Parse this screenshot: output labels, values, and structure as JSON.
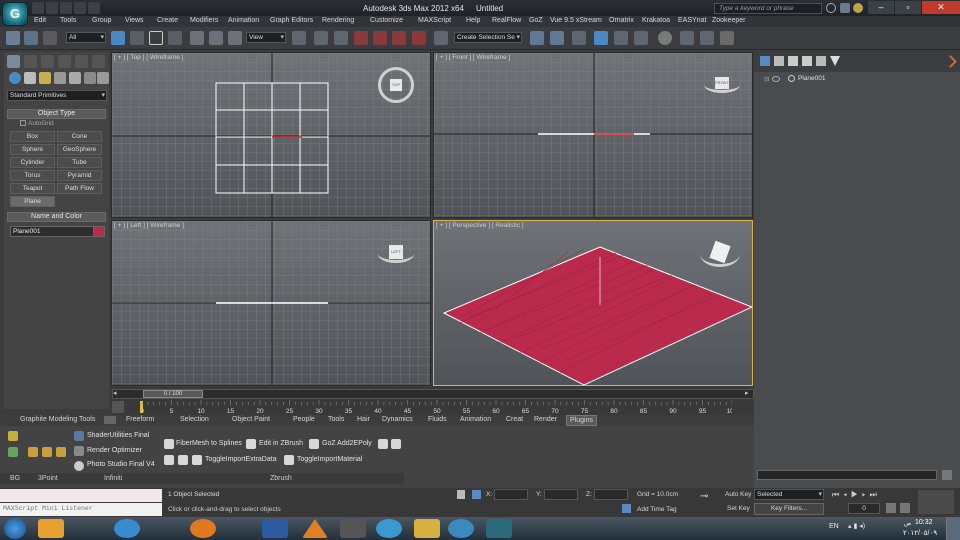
{
  "window": {
    "title_app": "Autodesk 3ds Max  2012 x64",
    "title_doc": "Untitled",
    "help_search_placeholder": "Type a keyword or phrase",
    "app_logo": "G"
  },
  "menubar": {
    "items": [
      "Edit",
      "Tools",
      "Group",
      "Views",
      "Create",
      "Modifiers",
      "Animation",
      "Graph Editors",
      "Rendering",
      "Customize",
      "MAXScript",
      "Help",
      "RealFlow",
      "GoZ",
      "Vue 9.5 xStream",
      "Ornatrix",
      "Krakatoa",
      "EASYnat",
      "Zookeeper"
    ]
  },
  "toolbar": {
    "selection_filter": "All",
    "ref_coord": "View",
    "named_selection_placeholder": "Create Selection Se"
  },
  "command_panel": {
    "category": "Standard Primitives",
    "object_type_title": "Object Type",
    "autogrid_label": "AutoGrid",
    "objects": [
      "Box",
      "Cone",
      "Sphere",
      "GeoSphere",
      "Cylinder",
      "Tube",
      "Torus",
      "Pyramid",
      "Teapot",
      "Path Flow",
      "Plane"
    ],
    "name_color_title": "Name and Color",
    "object_name": "Plane001",
    "object_color": "#b92a4d"
  },
  "viewports": {
    "top": "[ + ] [ Top ] [ Wireframe ]",
    "front": "[ + ] [ Front ] [ Wireframe ]",
    "left": "[ + ] [ Left ] [ Wireframe ]",
    "perspective": "[ + ] [ Perspective ] [ Realistic ]",
    "cube_top": "TOP",
    "cube_front": "FRONT",
    "cube_left": "LEFT"
  },
  "scene_explorer": {
    "items": [
      "Plane001"
    ]
  },
  "timeline": {
    "frame_indicator": "0 / 100",
    "ticks": [
      "0",
      "5",
      "10",
      "15",
      "20",
      "25",
      "30",
      "35",
      "40",
      "45",
      "50",
      "55",
      "60",
      "65",
      "70",
      "75",
      "80",
      "85",
      "90",
      "95",
      "100"
    ]
  },
  "ribbon": {
    "title": "Graphite Modeling Tools",
    "tabs": [
      "Freeform",
      "Selection",
      "Object Paint",
      "People",
      "Tools",
      "Hair",
      "Dynamics",
      "Fluids",
      "Animation",
      "Creat",
      "Render",
      "Plugins"
    ],
    "active_tab": "Plugins",
    "infiniti_buttons": [
      "ShaderUtilities Final",
      "Render Optimizer",
      "Photo Studio Final V4"
    ],
    "zbrush_buttons": [
      "FiberMesh to Splines",
      "Edit in ZBrush",
      "GoZ Add2EPoly",
      "ToggleImportExtraData",
      "ToggleImportMaterial"
    ],
    "group_labels": [
      "BG",
      "3Point",
      "Infiniti",
      "Zbrush"
    ]
  },
  "status": {
    "listener": "MAXScript Mini Listener",
    "selected": "1 Object Selected",
    "prompt": "Click or click-and-drag to select objects",
    "x_label": "X:",
    "y_label": "Y:",
    "z_label": "Z:",
    "grid": "Grid = 10.0cm",
    "add_time_tag": "Add Time Tag",
    "auto_key": "Auto Key",
    "set_key": "Set Key",
    "key_mode": "Selected",
    "key_filters": "Key Filters...",
    "frame": "0"
  },
  "tray": {
    "lang": "EN",
    "time": "10:32",
    "ampm": "ص",
    "date": "٢٠١٢/٠٥/٠٩"
  },
  "colors": {
    "plane": "#b92a4d",
    "accent": "#d9b24a"
  }
}
